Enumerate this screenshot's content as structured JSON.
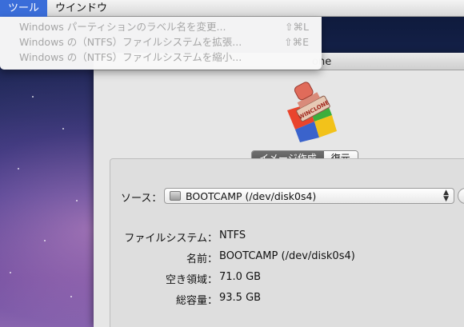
{
  "menubar": {
    "items": [
      {
        "label": "ツール",
        "active": true
      },
      {
        "label": "ウインドウ",
        "active": false
      }
    ]
  },
  "menu": {
    "items": [
      {
        "label": "Windows パーティションのラベル名を変更...",
        "shortcut": "⇧⌘L",
        "enabled": false
      },
      {
        "label": "Windows の（NTFS）ファイルシステムを拡張...",
        "shortcut": "⇧⌘E",
        "enabled": false
      },
      {
        "label": "Windows の（NTFS）ファイルシステムを縮小...",
        "shortcut": "",
        "enabled": false
      }
    ]
  },
  "window": {
    "title_visible": "one",
    "app_icon": "winclone-stamp-icon",
    "icon_text": "WINCLONE"
  },
  "tabs": [
    {
      "label": "イメージ作成",
      "selected": true
    },
    {
      "label": "復元",
      "selected": false
    }
  ],
  "source": {
    "label": "ソース：",
    "selected": "BOOTCAMP (/dev/disk0s4)"
  },
  "info": [
    {
      "label": "ファイルシステム：",
      "value": "NTFS"
    },
    {
      "label": "名前：",
      "value": "BOOTCAMP (/dev/disk0s4)"
    },
    {
      "label": "空き領域：",
      "value": "71.0 GB"
    },
    {
      "label": "総容量：",
      "value": "93.5 GB"
    }
  ],
  "colors": {
    "menu_highlight": "#3a6dd9",
    "disabled_text": "#a6a6a6",
    "selected_tab": "#555555"
  }
}
